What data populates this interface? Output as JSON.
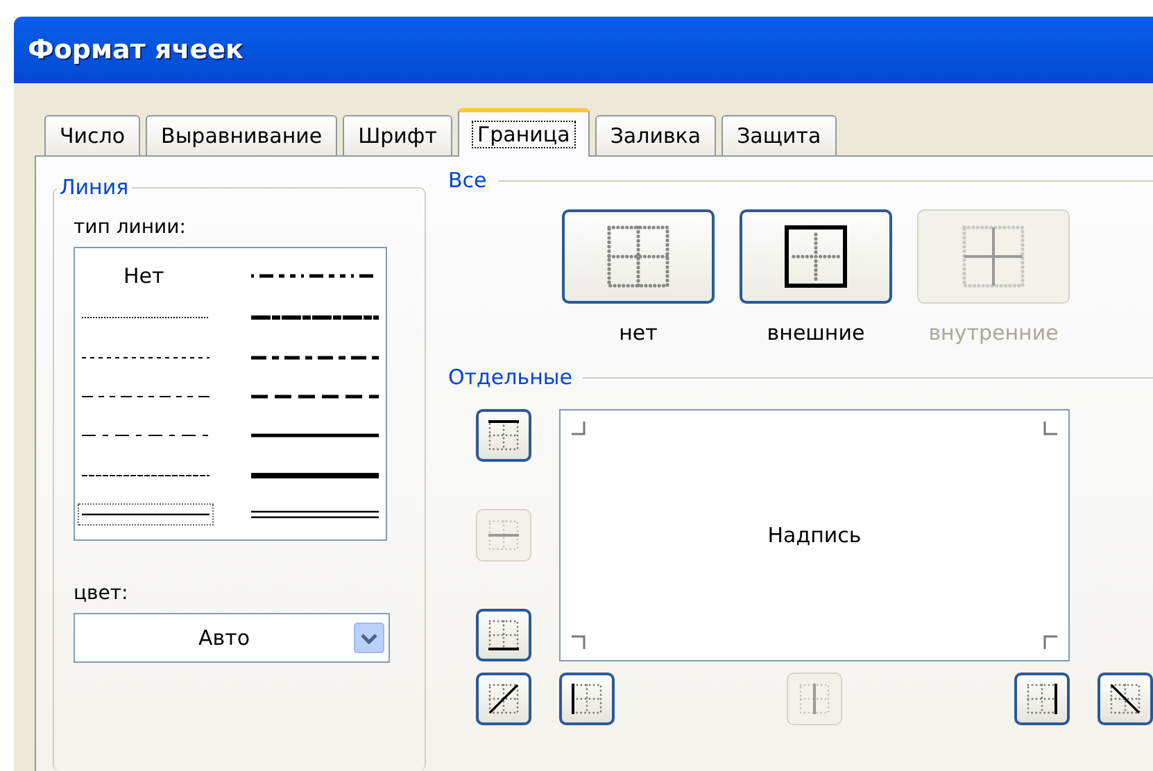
{
  "window": {
    "title": "Формат ячеек"
  },
  "tabs": [
    {
      "label": "Число",
      "selected": false
    },
    {
      "label": "Выравнивание",
      "selected": false
    },
    {
      "label": "Шрифт",
      "selected": false
    },
    {
      "label": "Граница",
      "selected": true
    },
    {
      "label": "Заливка",
      "selected": false
    },
    {
      "label": "Защита",
      "selected": false
    }
  ],
  "line_group": {
    "legend": "Линия",
    "style_label": "тип линии:",
    "styles": [
      {
        "kind": "none",
        "label": "Нет",
        "selected": false
      },
      {
        "kind": "medium_dash_dot_dot",
        "selected": false
      },
      {
        "kind": "hair",
        "selected": false
      },
      {
        "kind": "slant_dash_dot",
        "selected": false
      },
      {
        "kind": "dotted",
        "selected": false
      },
      {
        "kind": "medium_dash_dot",
        "selected": false
      },
      {
        "kind": "dash_dot_dot",
        "selected": false
      },
      {
        "kind": "medium_dashed",
        "selected": false
      },
      {
        "kind": "dash_dot",
        "selected": false
      },
      {
        "kind": "medium",
        "selected": false
      },
      {
        "kind": "dashed",
        "selected": false
      },
      {
        "kind": "thick",
        "selected": false
      },
      {
        "kind": "thin",
        "selected": true
      },
      {
        "kind": "double",
        "selected": false
      }
    ],
    "color_label": "цвет:",
    "color": {
      "value": "Авто"
    }
  },
  "presets": {
    "heading": "Все",
    "buttons": [
      {
        "kind": "none",
        "label": "нет",
        "disabled": false
      },
      {
        "kind": "outline",
        "label": "внешние",
        "disabled": false
      },
      {
        "kind": "inside",
        "label": "внутренние",
        "disabled": true
      }
    ]
  },
  "borders": {
    "heading": "Отдельные",
    "preview_text": "Надпись",
    "buttons": [
      {
        "kind": "top",
        "disabled": false
      },
      {
        "kind": "middle_horizontal",
        "disabled": true
      },
      {
        "kind": "bottom",
        "disabled": false
      },
      {
        "kind": "diagonal_up",
        "disabled": false
      },
      {
        "kind": "left",
        "disabled": false
      },
      {
        "kind": "middle_vertical",
        "disabled": true
      },
      {
        "kind": "right",
        "disabled": false
      },
      {
        "kind": "diagonal_down",
        "disabled": false
      }
    ]
  }
}
